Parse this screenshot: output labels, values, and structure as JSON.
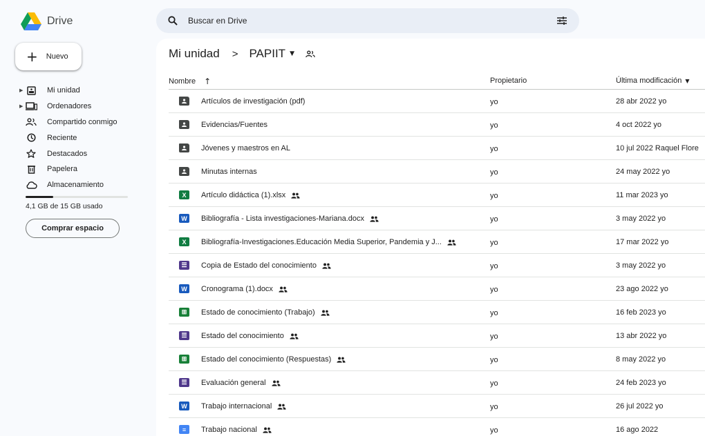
{
  "app": {
    "name": "Drive"
  },
  "search": {
    "placeholder": "Buscar en Drive",
    "value": ""
  },
  "new_button": {
    "label": "Nuevo"
  },
  "nav": [
    {
      "label": "Mi unidad",
      "icon": "my-drive-icon",
      "expandable": true
    },
    {
      "label": "Ordenadores",
      "icon": "computer-icon",
      "expandable": true
    },
    {
      "label": "Compartido conmigo",
      "icon": "shared-with-me-icon",
      "expandable": false
    },
    {
      "label": "Reciente",
      "icon": "clock-icon",
      "expandable": false
    },
    {
      "label": "Destacados",
      "icon": "star-icon",
      "expandable": false
    },
    {
      "label": "Papelera",
      "icon": "trash-icon",
      "expandable": false
    },
    {
      "label": "Almacenamiento",
      "icon": "cloud-icon",
      "expandable": false
    }
  ],
  "storage": {
    "used_text": "4,1 GB de 15 GB usado",
    "used_fraction": 0.273,
    "buy_label": "Comprar espacio"
  },
  "breadcrumb": {
    "root": "Mi unidad",
    "separator": ">",
    "current": "PAPIIT"
  },
  "table": {
    "headers": {
      "name": "Nombre",
      "owner": "Propietario",
      "modified": "Última modificación"
    },
    "rows": [
      {
        "type": "folder",
        "name": "Artículos de investigación (pdf)",
        "shared": false,
        "owner": "yo",
        "modified": "28 abr 2022 yo"
      },
      {
        "type": "folder",
        "name": "Evidencias/Fuentes",
        "shared": false,
        "owner": "yo",
        "modified": "4 oct 2022 yo"
      },
      {
        "type": "folder",
        "name": "Jóvenes y maestros en AL",
        "shared": false,
        "owner": "yo",
        "modified": "10 jul 2022 Raquel Flore"
      },
      {
        "type": "folder",
        "name": "Minutas internas",
        "shared": false,
        "owner": "yo",
        "modified": "24 may 2022 yo"
      },
      {
        "type": "excel",
        "name": "Artículo didáctica (1).xlsx",
        "shared": true,
        "owner": "yo",
        "modified": "11 mar 2023 yo"
      },
      {
        "type": "word",
        "name": "Bibliografía - Lista investigaciones-Mariana.docx",
        "shared": true,
        "owner": "yo",
        "modified": "3 may 2022 yo"
      },
      {
        "type": "excel",
        "name": "Bibliografía-Investigaciones.Educación Media Superior, Pandemia y J...",
        "shared": true,
        "owner": "yo",
        "modified": "17 mar 2022 yo"
      },
      {
        "type": "forms",
        "name": "Copia de Estado del conocimiento",
        "shared": true,
        "owner": "yo",
        "modified": "3 may 2022 yo"
      },
      {
        "type": "word",
        "name": "Cronograma (1).docx",
        "shared": true,
        "owner": "yo",
        "modified": "23 ago 2022 yo"
      },
      {
        "type": "sheets",
        "name": "Estado de conocimiento (Trabajo)",
        "shared": true,
        "owner": "yo",
        "modified": "16 feb 2023 yo"
      },
      {
        "type": "forms",
        "name": "Estado del conocimiento",
        "shared": true,
        "owner": "yo",
        "modified": "13 abr 2022 yo"
      },
      {
        "type": "sheets",
        "name": "Estado del conocimiento  (Respuestas)",
        "shared": true,
        "owner": "yo",
        "modified": "8 may 2022 yo"
      },
      {
        "type": "forms",
        "name": "Evaluación general",
        "shared": true,
        "owner": "yo",
        "modified": "24 feb 2023 yo"
      },
      {
        "type": "word",
        "name": "Trabajo internacional",
        "shared": true,
        "owner": "yo",
        "modified": "26 jul 2022 yo"
      },
      {
        "type": "docs",
        "name": "Trabajo nacional",
        "shared": true,
        "owner": "yo",
        "modified": "16 ago 2022"
      }
    ]
  }
}
